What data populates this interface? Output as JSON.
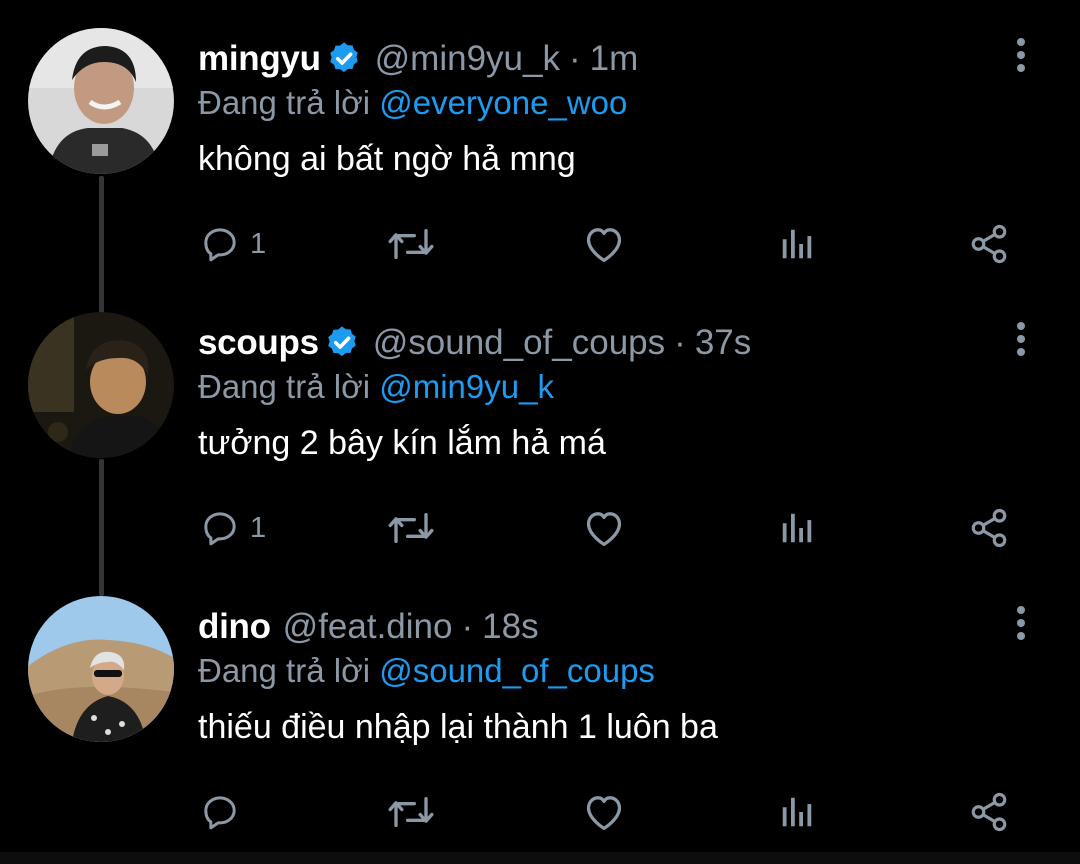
{
  "colors": {
    "background": "#000000",
    "text_primary": "#ffffff",
    "text_secondary": "#8b98a5",
    "mention": "#1d9bf0",
    "verified": "#1d9bf0",
    "thread_line": "#333639"
  },
  "reply_prefix": "Đang trả lời",
  "tweets": [
    {
      "name": "mingyu",
      "verified": true,
      "handle": "@min9yu_k",
      "separator": "·",
      "time": "1m",
      "reply_to": "@everyone_woo",
      "text": "không ai bất ngờ hả mng",
      "reply_count": "1",
      "avatar_icon": "avatar-photo-icon"
    },
    {
      "name": "scoups",
      "verified": true,
      "handle": "@sound_of_coups",
      "separator": "·",
      "time": "37s",
      "reply_to": "@min9yu_k",
      "text": "tưởng 2 bây kín lắm hả má",
      "reply_count": "1",
      "avatar_icon": "avatar-photo-icon"
    },
    {
      "name": "dino",
      "verified": false,
      "handle": "@feat.dino",
      "separator": "·",
      "time": "18s",
      "reply_to": "@sound_of_coups",
      "text": "thiếu điều nhập lại thành 1 luôn ba",
      "reply_count": "",
      "avatar_icon": "avatar-photo-icon"
    }
  ],
  "action_icons": [
    "reply-icon",
    "retweet-icon",
    "like-icon",
    "analytics-icon",
    "share-icon"
  ]
}
